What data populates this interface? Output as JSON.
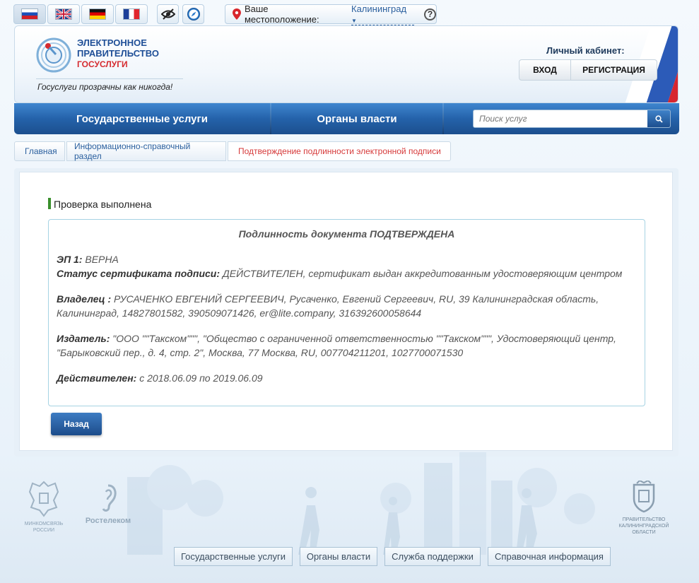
{
  "topbar": {
    "languages": [
      {
        "name": "ru",
        "active": true
      },
      {
        "name": "en",
        "active": false
      },
      {
        "name": "de",
        "active": false
      },
      {
        "name": "fr",
        "active": false
      }
    ],
    "location_label": "Ваше местоположение:",
    "location_value": "Калининград",
    "help": "?"
  },
  "header": {
    "logo_line1": "ЭЛЕКТРОННОЕ",
    "logo_line2": "ПРАВИТЕЛЬСТВО",
    "logo_line3": "ГОСУСЛУГИ",
    "slogan": "Госуслуги прозрачны как никогда!",
    "cabinet_label": "Личный кабинет:",
    "login_label": "ВХОД",
    "register_label": "РЕГИСТРАЦИЯ"
  },
  "nav": {
    "services": "Государственные услуги",
    "authorities": "Органы власти",
    "search_placeholder": "Поиск услуг"
  },
  "breadcrumb": {
    "home": "Главная",
    "section": "Информационно-справочный раздел",
    "current": "Подтверждение подлинности электронной подписи"
  },
  "main": {
    "status_title": "Проверка выполнена",
    "result_heading": "Подлинность документа ПОДТВЕРЖДЕНА",
    "sig_label": "ЭП 1:",
    "sig_value": "ВЕРНА",
    "cert_label": "Статус сертификата подписи:",
    "cert_value": "ДЕЙСТВИТЕЛЕН, сертификат выдан аккредитованным удостоверяющим центром",
    "owner_label": "Владелец :",
    "owner_value_1": "РУСАЧЕНКО ЕВГЕНИЙ СЕРГЕЕВИЧ, Русаченко, Евгений Сергеевич, RU, 39 Калининградская область,",
    "owner_value_2": "Калининград, 14827801582, 390509071426, er@lite.company, 316392600058644",
    "issuer_label": "Издатель:",
    "issuer_value_1": "\"ООО \"\"Такском\"\"\", \"Общество с ограниченной ответственностью \"\"Такском\"\"\", Удостоверяющий центр,",
    "issuer_value_2": "\"Барыковский пер., д. 4, стр. 2\", Москва, 77 Москва, RU, 007704211201, 1027700071530",
    "valid_label": "Действителен:",
    "valid_value": "с 2018.06.09 по 2019.06.09",
    "back_label": "Назад"
  },
  "footer": {
    "minsvyaz": "МИНКОМСВЯЗЬ РОССИИ",
    "rostelecom": "Ростелеком",
    "kaliningrad_gov": "ПРАВИТЕЛЬСТВО КАЛИНИНГРАДСКОЙ ОБЛАСТИ",
    "links": [
      "Государственные услуги",
      "Органы власти",
      "Служба поддержки",
      "Справочная информация"
    ]
  }
}
